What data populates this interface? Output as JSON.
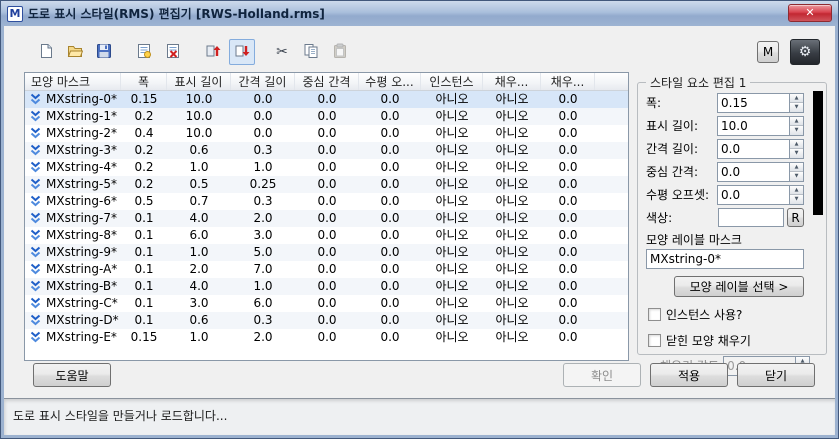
{
  "window": {
    "title": "도로 표시 스타일(RMS) 편집기 [RWS-Holland.rms]",
    "app_icon_letter": "M",
    "close_label": "✕"
  },
  "toolbar": {
    "buttons": [
      {
        "id": "new-file",
        "icon": "new-document-icon"
      },
      {
        "id": "open-file",
        "icon": "open-folder-icon"
      },
      {
        "id": "save-file",
        "icon": "save-floppy-icon"
      },
      {
        "id": "add-style",
        "icon": "add-style-icon"
      },
      {
        "id": "delete-style",
        "icon": "delete-style-icon"
      },
      {
        "id": "style-import",
        "icon": "red-arrow-up-icon"
      },
      {
        "id": "style-export",
        "icon": "red-arrow-down-icon",
        "active": true
      },
      {
        "id": "cut",
        "icon": "scissors-icon"
      },
      {
        "id": "copy",
        "icon": "copy-icon"
      },
      {
        "id": "paste",
        "icon": "paste-icon",
        "disabled": true
      }
    ],
    "m_button": "M",
    "settings_icon": "gear-icon",
    "gear_glyph": "⚙",
    "cut_glyph": "✂"
  },
  "table": {
    "columns": [
      "모양 마스크",
      "폭",
      "표시 길이",
      "간격 길이",
      "중심 간격",
      "수평 오...",
      "인스턴스",
      "채우...",
      "채우..."
    ],
    "row_icon": "blue-double-chevron-icon",
    "rows": [
      {
        "mask": "MXstring-0*",
        "width": "0.15",
        "display_length": "10.0",
        "gap_length": "0.0",
        "center_gap": "0.0",
        "h_offset": "0.0",
        "instance": "아니오",
        "fill": "아니오",
        "fill_angle": "0.0",
        "selected": true
      },
      {
        "mask": "MXstring-1*",
        "width": "0.2",
        "display_length": "10.0",
        "gap_length": "0.0",
        "center_gap": "0.0",
        "h_offset": "0.0",
        "instance": "아니오",
        "fill": "아니오",
        "fill_angle": "0.0"
      },
      {
        "mask": "MXstring-2*",
        "width": "0.4",
        "display_length": "10.0",
        "gap_length": "0.0",
        "center_gap": "0.0",
        "h_offset": "0.0",
        "instance": "아니오",
        "fill": "아니오",
        "fill_angle": "0.0"
      },
      {
        "mask": "MXstring-3*",
        "width": "0.2",
        "display_length": "0.6",
        "gap_length": "0.3",
        "center_gap": "0.0",
        "h_offset": "0.0",
        "instance": "아니오",
        "fill": "아니오",
        "fill_angle": "0.0"
      },
      {
        "mask": "MXstring-4*",
        "width": "0.2",
        "display_length": "1.0",
        "gap_length": "1.0",
        "center_gap": "0.0",
        "h_offset": "0.0",
        "instance": "아니오",
        "fill": "아니오",
        "fill_angle": "0.0"
      },
      {
        "mask": "MXstring-5*",
        "width": "0.2",
        "display_length": "0.5",
        "gap_length": "0.25",
        "center_gap": "0.0",
        "h_offset": "0.0",
        "instance": "아니오",
        "fill": "아니오",
        "fill_angle": "0.0"
      },
      {
        "mask": "MXstring-6*",
        "width": "0.5",
        "display_length": "0.7",
        "gap_length": "0.3",
        "center_gap": "0.0",
        "h_offset": "0.0",
        "instance": "아니오",
        "fill": "아니오",
        "fill_angle": "0.0"
      },
      {
        "mask": "MXstring-7*",
        "width": "0.1",
        "display_length": "4.0",
        "gap_length": "2.0",
        "center_gap": "0.0",
        "h_offset": "0.0",
        "instance": "아니오",
        "fill": "아니오",
        "fill_angle": "0.0"
      },
      {
        "mask": "MXstring-8*",
        "width": "0.1",
        "display_length": "6.0",
        "gap_length": "3.0",
        "center_gap": "0.0",
        "h_offset": "0.0",
        "instance": "아니오",
        "fill": "아니오",
        "fill_angle": "0.0"
      },
      {
        "mask": "MXstring-9*",
        "width": "0.1",
        "display_length": "1.0",
        "gap_length": "5.0",
        "center_gap": "0.0",
        "h_offset": "0.0",
        "instance": "아니오",
        "fill": "아니오",
        "fill_angle": "0.0"
      },
      {
        "mask": "MXstring-A*",
        "width": "0.1",
        "display_length": "2.0",
        "gap_length": "7.0",
        "center_gap": "0.0",
        "h_offset": "0.0",
        "instance": "아니오",
        "fill": "아니오",
        "fill_angle": "0.0"
      },
      {
        "mask": "MXstring-B*",
        "width": "0.1",
        "display_length": "4.0",
        "gap_length": "1.0",
        "center_gap": "0.0",
        "h_offset": "0.0",
        "instance": "아니오",
        "fill": "아니오",
        "fill_angle": "0.0"
      },
      {
        "mask": "MXstring-C*",
        "width": "0.1",
        "display_length": "3.0",
        "gap_length": "6.0",
        "center_gap": "0.0",
        "h_offset": "0.0",
        "instance": "아니오",
        "fill": "아니오",
        "fill_angle": "0.0"
      },
      {
        "mask": "MXstring-D*",
        "width": "0.1",
        "display_length": "0.6",
        "gap_length": "0.3",
        "center_gap": "0.0",
        "h_offset": "0.0",
        "instance": "아니오",
        "fill": "아니오",
        "fill_angle": "0.0"
      },
      {
        "mask": "MXstring-E*",
        "width": "0.15",
        "display_length": "1.0",
        "gap_length": "2.0",
        "center_gap": "0.0",
        "h_offset": "0.0",
        "instance": "아니오",
        "fill": "아니오",
        "fill_angle": "0.0"
      }
    ]
  },
  "edit_panel": {
    "title": "스타일 요소 편집 1",
    "fields": [
      {
        "label": "폭:",
        "value": "0.15"
      },
      {
        "label": "표시 길이:",
        "value": "10.0"
      },
      {
        "label": "간격 길이:",
        "value": "0.0"
      },
      {
        "label": "중심 간격:",
        "value": "0.0"
      },
      {
        "label": "수평 오프셋:",
        "value": "0.0"
      }
    ],
    "color_label": "색상:",
    "color_value": "",
    "color_reset_label": "R",
    "mask_label": "모양 레이블 마스크",
    "mask_value": "MXstring-0*",
    "select_button": "모양 레이블 선택 >",
    "instance_checkbox": "인스턴스 사용?",
    "fill_checkbox": "닫힌 모양 채우기",
    "fill_angle_label": "채우기 각도:",
    "fill_angle_value": "0.0",
    "preview_color": "#000000"
  },
  "footer": {
    "help": "도움말",
    "ok": "확인",
    "apply": "적용",
    "close": "닫기"
  },
  "status_bar": "도로 표시 스타일을 만들거나 로드합니다..."
}
